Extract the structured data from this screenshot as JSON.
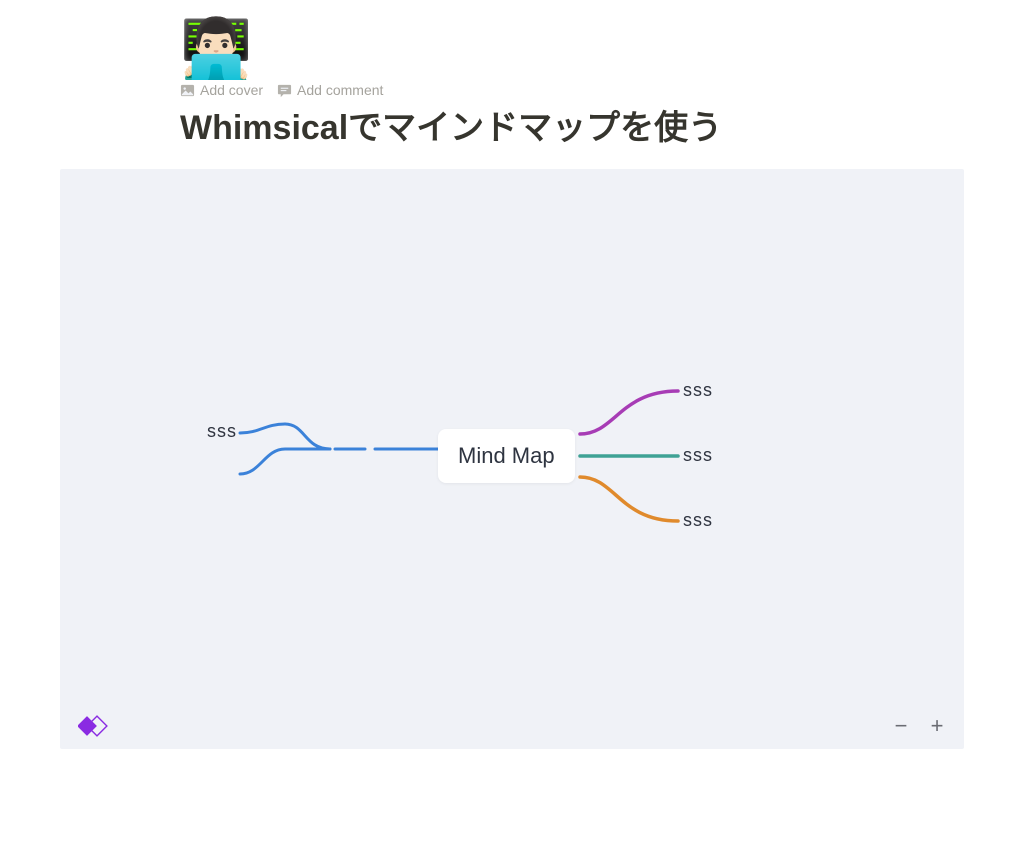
{
  "header": {
    "icon_emoji": "👨🏻‍💻",
    "actions": {
      "add_cover": "Add cover",
      "add_comment": "Add comment"
    },
    "title": "Whimsicalでマインドマップを使う"
  },
  "mindmap": {
    "center_label": "Mind Map",
    "left_node": "sss",
    "right_nodes": [
      "sss",
      "sss",
      "sss"
    ],
    "colors": {
      "left_branch": "#3b82d9",
      "right_top": "#a73cb5",
      "right_mid": "#3fa295",
      "right_bot": "#e08a2c"
    }
  },
  "zoom": {
    "minus": "−",
    "plus": "+"
  }
}
